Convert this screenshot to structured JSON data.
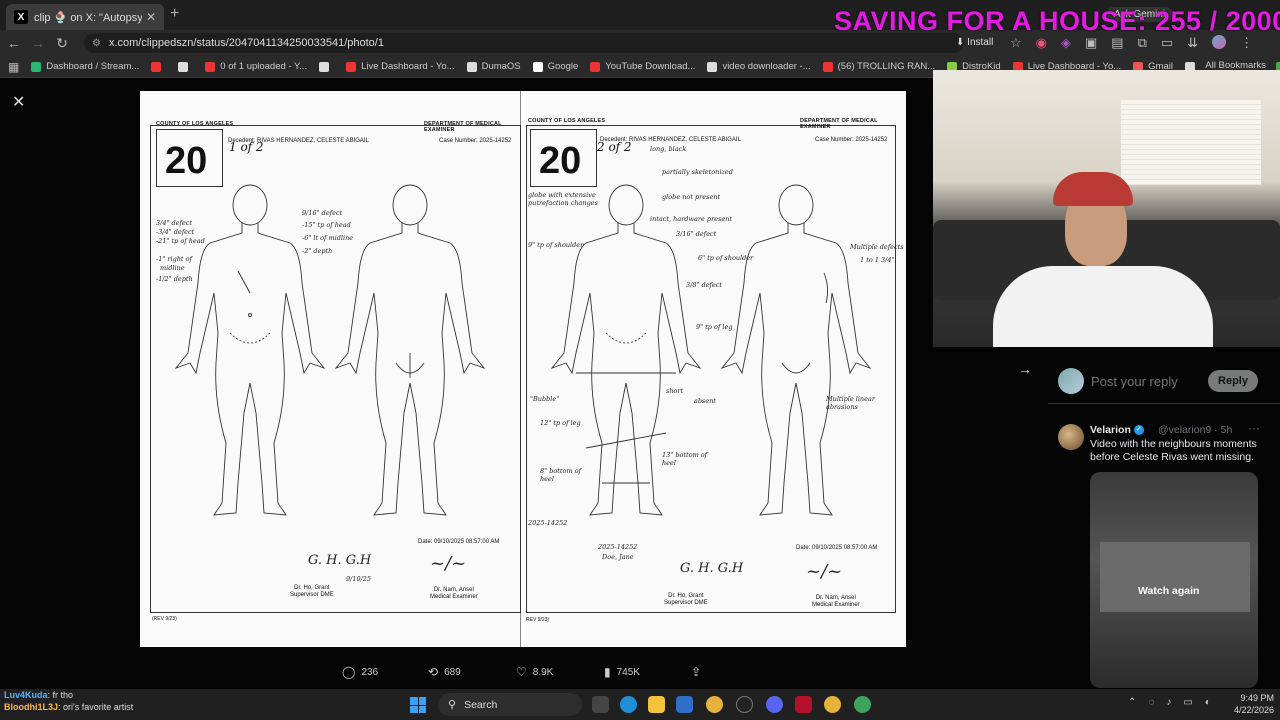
{
  "browser": {
    "tab_title": "clip 🍨 on X: \"Autopsy details",
    "tab_favicon": "X",
    "ask_gemini": "Ask Gemini",
    "url": "x.com/clippedszn/status/2047041134250033541/photo/1",
    "install_label": "Install",
    "all_bookmarks": "All Bookmarks",
    "bookmarks": [
      {
        "label": "Dashboard / Stream...",
        "color": "#2bb673"
      },
      {
        "label": "",
        "color": "#e33"
      },
      {
        "label": "",
        "color": "#ddd"
      },
      {
        "label": "0 of 1 uploaded - Y...",
        "color": "#e33"
      },
      {
        "label": "",
        "color": "#ddd"
      },
      {
        "label": "Live Dashboard - Yo...",
        "color": "#e33"
      },
      {
        "label": "DumaOS",
        "color": "#ddd"
      },
      {
        "label": "Google",
        "color": "#fff"
      },
      {
        "label": "YouTube Download...",
        "color": "#e33"
      },
      {
        "label": "video downloader -...",
        "color": "#ddd"
      },
      {
        "label": "(56) TROLLING RAN...",
        "color": "#e33"
      },
      {
        "label": "DistroKid",
        "color": "#8c4"
      },
      {
        "label": "Live Dashboard - Yo...",
        "color": "#e33"
      },
      {
        "label": "Gmail",
        "color": "#e55"
      },
      {
        "label": "",
        "color": "#ddd"
      },
      {
        "label": "YouTube",
        "color": "#e33"
      },
      {
        "label": "Maps",
        "color": "#4a4"
      }
    ]
  },
  "document": {
    "left": {
      "county": "COUNTY OF LOS ANGELES",
      "department": "DEPARTMENT OF MEDICAL EXAMINER",
      "decedent": "Decedent: RIVAS HERNANDEZ, CELESTE ABIGAIL",
      "case_number": "Case Number: 2025-14252",
      "page_number": "20",
      "page_of": "1 of 2",
      "date": "Date: 09/10/2025 08:57:00 AM",
      "supervisor": "Dr. Ho, Grant\nSupervisor DME",
      "examiner": "Dr. Nam, Ansel\nMedical Examiner",
      "rev": "(REV 9/23)",
      "sup_sig": "G. H. G.H",
      "exam_sig": "~/~",
      "sig_date": "9/10/25",
      "notes": [
        "3/4\" defect",
        "-3/4\" defect",
        "-21\" tp of head",
        "-1\" right of",
        "midline",
        "-1/2\" depth",
        "9/16\" defect",
        "-15\" tp of head",
        "-6\" lt of midline",
        "-2\" depth"
      ]
    },
    "right": {
      "county": "COUNTY OF LOS ANGELES",
      "department": "DEPARTMENT OF MEDICAL EXAMINER",
      "decedent": "Decedent: RIVAS HERNANDEZ, CELESTE ABIGAIL",
      "case_number": "Case Number: 2025-14252",
      "page_number": "20",
      "page_of": "2 of 2",
      "date": "Date: 09/10/2025 08:57:00 AM",
      "supervisor": "Dr. Ho, Grant\nSupervisor DME",
      "examiner": "Dr. Nam, Ansel\nMedical Examiner",
      "rev": "REV 9/23)",
      "notes": [
        "long, black",
        "partially skeletonized",
        "globe with extensive putrefaction changes",
        "globe not present",
        "intact, hardware present",
        "3/16\" defect",
        "9\" tp of shoulder",
        "6\" tp of shoulder",
        "3/8\" defect",
        "Multiple defects",
        "1 to 1 3/4\"",
        "9\" tp of leg",
        "short",
        "absent",
        "\"Bubble\"",
        "12\" tp of leg",
        "13\" bottom of heel",
        "8\" bottom of heel",
        "2025-14252",
        "2025-14252",
        "Doe, Jane",
        "Multiple linear abrasions"
      ]
    }
  },
  "actions": {
    "replies": "236",
    "reposts": "689",
    "likes": "8.9K",
    "views": "745K"
  },
  "reply": {
    "placeholder": "Post your reply",
    "button": "Reply"
  },
  "tweet": {
    "name": "Velarion",
    "handle": "@velarion9 · 5h",
    "text": "Video with the neighbours moments before Celeste Rivas went missing.",
    "watch_again": "Watch again"
  },
  "overlay": {
    "title": "SAVING FOR A HOUSE: 255 / 20000"
  },
  "chat": [
    {
      "user": "Luv4Kuda",
      "msg": ": fr tho"
    },
    {
      "user": "Bloodhi1L3J",
      "msg": ": ori's favorite artist"
    }
  ],
  "taskbar": {
    "search_label": "Search",
    "time": "9:49 PM",
    "date": "4/22/2026"
  },
  "colors": {
    "overlay_magenta": "#e619e6",
    "x_blue": "#1d9bf0",
    "windows_blue": "#3aa0f3"
  }
}
